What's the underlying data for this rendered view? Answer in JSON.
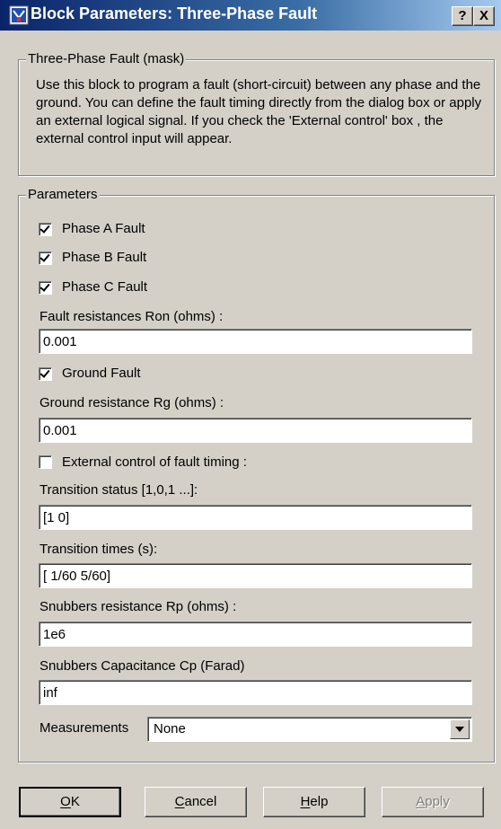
{
  "window": {
    "title": "Block Parameters: Three-Phase Fault",
    "help_btn": "?",
    "close_btn": "X"
  },
  "mask": {
    "legend": "Three-Phase Fault (mask)",
    "description": "Use this block to program a fault (short-circuit) between any phase and the ground. You can define the fault timing directly from the dialog box or apply an external logical signal. If you check the 'External control' box , the external control input will appear."
  },
  "params": {
    "legend": "Parameters",
    "phase_a": {
      "label": "Phase A Fault",
      "checked": true
    },
    "phase_b": {
      "label": "Phase B Fault",
      "checked": true
    },
    "phase_c": {
      "label": "Phase C Fault",
      "checked": true
    },
    "fault_res": {
      "label": "Fault resistances  Ron (ohms) :",
      "value": "0.001"
    },
    "ground_fault": {
      "label": "Ground Fault",
      "checked": true
    },
    "ground_res": {
      "label": "Ground resistance Rg (ohms) :",
      "value": "0.001"
    },
    "external": {
      "label": "External control of fault timing :",
      "checked": false
    },
    "trans_status": {
      "label": "Transition status [1,0,1 ...]:",
      "value": "[1 0]"
    },
    "trans_times": {
      "label": "Transition times (s):",
      "value": "[ 1/60 5/60]"
    },
    "snub_res": {
      "label": "Snubbers resistance Rp (ohms) :",
      "value": "1e6"
    },
    "snub_cap": {
      "label": "Snubbers Capacitance Cp (Farad)",
      "value": "inf"
    },
    "measurements": {
      "label": "Measurements",
      "value": "None"
    }
  },
  "buttons": {
    "ok_u": "O",
    "ok_rest": "K",
    "cancel_u": "C",
    "cancel_rest": "ancel",
    "help_u": "H",
    "help_rest": "elp",
    "apply_u": "A",
    "apply_rest": "pply"
  }
}
